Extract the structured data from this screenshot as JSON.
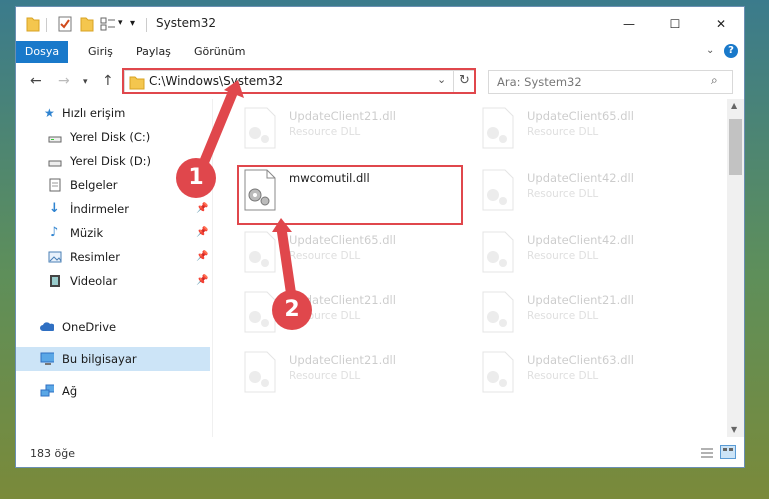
{
  "window": {
    "title": "System32",
    "controls": {
      "minimize": "—",
      "maximize": "☐",
      "close": "✕"
    }
  },
  "ribbon": {
    "tabs": [
      "Dosya",
      "Giriş",
      "Paylaş",
      "Görünüm"
    ],
    "expand_icon": "chevron-down-icon",
    "help": "?"
  },
  "nav": {
    "address": "C:\\Windows\\System32",
    "search_placeholder": "Ara: System32",
    "refresh": "↻"
  },
  "sidebar": {
    "items": [
      {
        "label": "Hızlı erişim",
        "icon": "star-icon"
      },
      {
        "label": "Yerel Disk (C:)",
        "icon": "drive-icon"
      },
      {
        "label": "Yerel Disk (D:)",
        "icon": "drive-icon"
      },
      {
        "label": "Belgeler",
        "icon": "document-icon"
      },
      {
        "label": "İndirmeler",
        "icon": "download-icon"
      },
      {
        "label": "Müzik",
        "icon": "music-icon"
      },
      {
        "label": "Resimler",
        "icon": "pictures-icon"
      },
      {
        "label": "Videolar",
        "icon": "video-icon"
      },
      {
        "label": "OneDrive",
        "icon": "cloud-icon"
      },
      {
        "label": "Bu bilgisayar",
        "icon": "computer-icon"
      },
      {
        "label": "Ağ",
        "icon": "network-icon"
      }
    ]
  },
  "files": [
    {
      "name": "UpdateClient21.dll",
      "type": "Resource DLL"
    },
    {
      "name": "UpdateClient65.dll",
      "type": "Resource DLL"
    },
    {
      "name": "mwcomutil.dll",
      "type": ""
    },
    {
      "name": "UpdateClient42.dll",
      "type": "Resource DLL"
    },
    {
      "name": "UpdateClient65.dll",
      "type": "Resource DLL"
    },
    {
      "name": "UpdateClient42.dll",
      "type": "Resource DLL"
    },
    {
      "name": "UpdateClient21.dll",
      "type": "Resource DLL"
    },
    {
      "name": "UpdateClient21.dll",
      "type": "Resource DLL"
    },
    {
      "name": "UpdateClient21.dll",
      "type": "Resource DLL"
    },
    {
      "name": "UpdateClient63.dll",
      "type": "Resource DLL"
    }
  ],
  "annotations": {
    "step1": "1",
    "step2": "2",
    "color": "#e0474c"
  },
  "status": {
    "count": "183 öğe"
  }
}
